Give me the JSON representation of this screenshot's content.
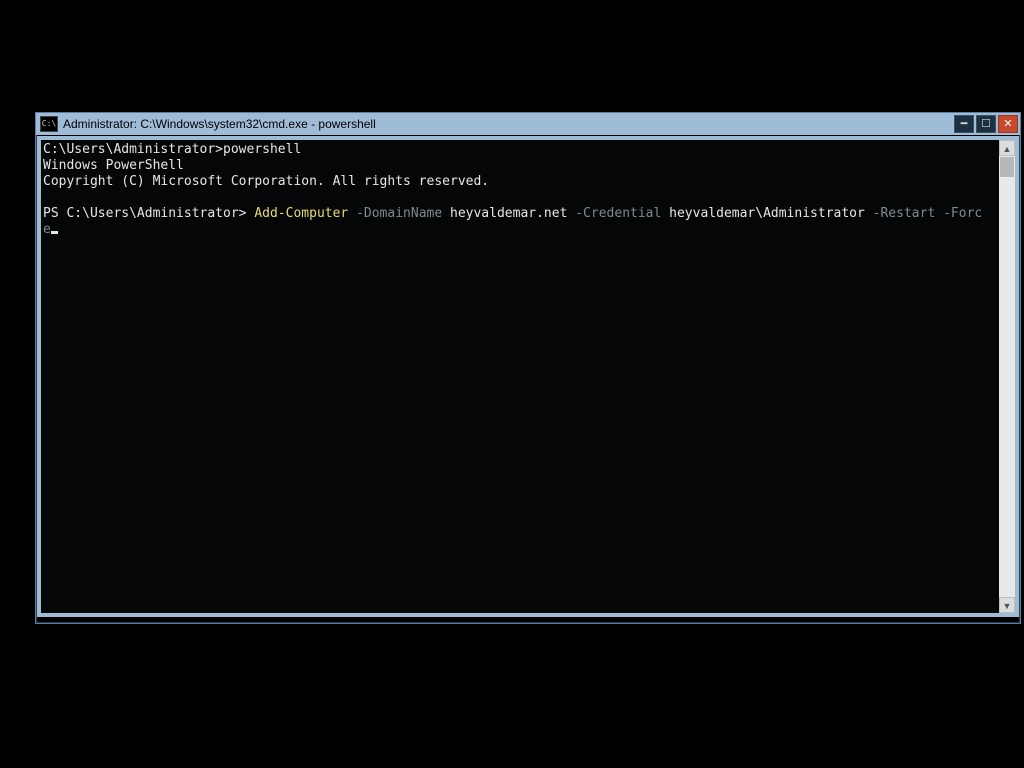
{
  "window": {
    "title": "Administrator: C:\\Windows\\system32\\cmd.exe - powershell",
    "icon_label": "C:\\",
    "controls": {
      "minimize": "━",
      "maximize": "☐",
      "close": "✕"
    }
  },
  "console": {
    "line1_prompt": "C:\\Users\\Administrator>",
    "line1_cmd": "powershell",
    "line2": "Windows PowerShell",
    "line3": "Copyright (C) Microsoft Corporation. All rights reserved.",
    "ps_prompt": "PS C:\\Users\\Administrator> ",
    "cmdlet": "Add-Computer",
    "param1": " -DomainName",
    "arg1": " heyvaldemar.net",
    "param2": " -Credential",
    "arg2": " heyvaldemar\\Administrator",
    "param3": " -Restart",
    "param4": " -Forc",
    "wrap_char": "e"
  },
  "scrollbar": {
    "up": "▲",
    "down": "▼"
  }
}
